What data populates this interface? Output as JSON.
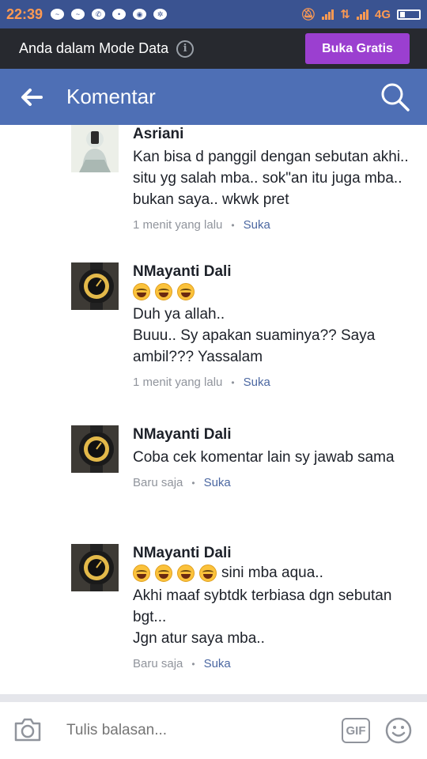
{
  "status_bar": {
    "time": "22:39",
    "network": "4G",
    "notification_icons": [
      "messenger-icon",
      "messenger-icon",
      "whatsapp-icon",
      "lite-icon",
      "chrome-icon",
      "settings-icon"
    ]
  },
  "data_banner": {
    "text": "Anda dalam Mode Data",
    "button_label": "Buka Gratis"
  },
  "app_bar": {
    "title": "Komentar"
  },
  "comments": [
    {
      "author": "Asriani",
      "text": "Kan bisa d panggil dengan sebutan akhi.. situ yg salah mba.. sok\"an itu juga mba.. bukan saya.. wkwk pret",
      "time": "1 menit yang lalu",
      "like_label": "Suka"
    },
    {
      "author": "NMayanti Dali",
      "emoji_count": 3,
      "emoji_suffix": "",
      "text": "Duh ya allah..\nBuuu.. Sy apakan suaminya?? Saya ambil???  Yassalam",
      "time": "1 menit yang lalu",
      "like_label": "Suka"
    },
    {
      "author": "NMayanti Dali",
      "text": "Coba cek komentar lain sy jawab sama",
      "time": "Baru saja",
      "like_label": "Suka"
    },
    {
      "author": "NMayanti Dali",
      "emoji_count": 4,
      "emoji_suffix": "sini mba aqua..",
      "text": "Akhi maaf sybtdk terbiasa dgn sebutan bgt...\nJgn atur saya mba..",
      "time": "Baru saja",
      "like_label": "Suka"
    }
  ],
  "composer": {
    "placeholder": "Tulis balasan...",
    "gif_label": "GIF"
  },
  "colors": {
    "facebook_blue": "#4e6fb5",
    "status_bar": "#3a5391",
    "free_button": "#9b3fd0",
    "link": "#4b67a1"
  }
}
